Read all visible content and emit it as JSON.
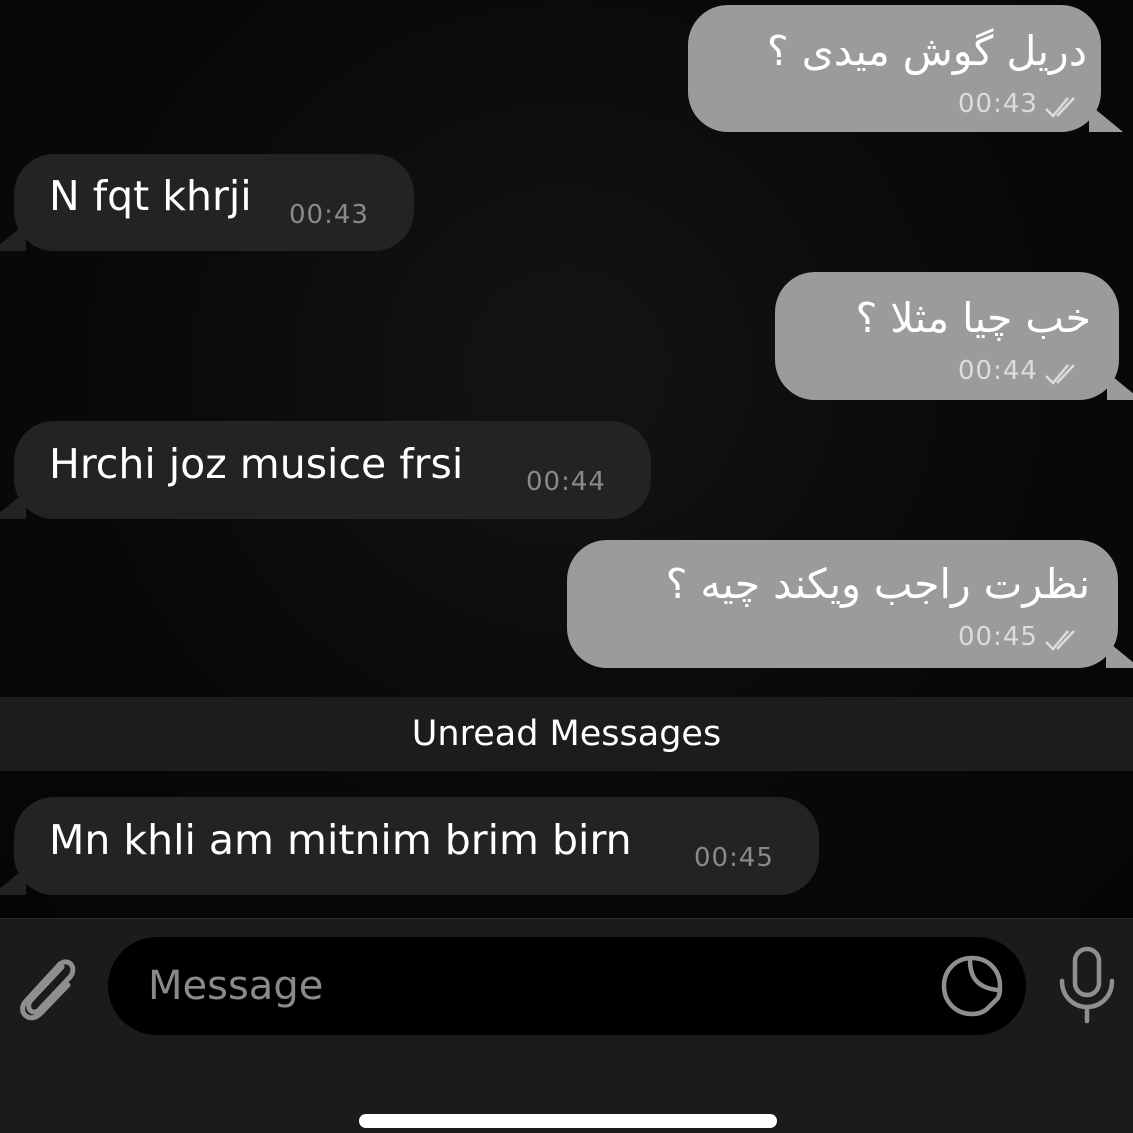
{
  "messages": [
    {
      "direction": "out",
      "text": "دریل گوش میدی ؟",
      "time": "00:43",
      "status": "read"
    },
    {
      "direction": "in",
      "text": "N fqt khrji",
      "time": "00:43"
    },
    {
      "direction": "out",
      "text": "خب چیا مثلا ؟",
      "time": "00:44",
      "status": "read"
    },
    {
      "direction": "in",
      "text": "Hrchi joz musice frsi",
      "time": "00:44"
    },
    {
      "direction": "out",
      "text": "نظرت راجب ویکند چیه ؟",
      "time": "00:45",
      "status": "read"
    },
    {
      "direction": "in",
      "text": "Mn khli am mitnim brim birn",
      "time": "00:45"
    }
  ],
  "unread_label": "Unread Messages",
  "composer": {
    "placeholder": "Message",
    "attach_icon": "paperclip-icon",
    "sticker_icon": "sticker-icon",
    "mic_icon": "microphone-icon"
  },
  "colors": {
    "outgoing_bubble": "#9b9b9b",
    "incoming_bubble": "#232323",
    "background": "#050505"
  }
}
